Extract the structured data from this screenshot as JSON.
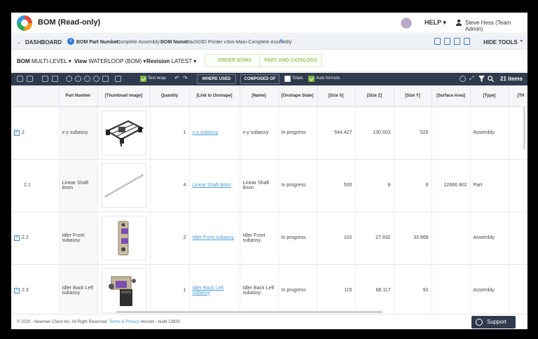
{
  "app": {
    "title": "BOM (Read-only)"
  },
  "header": {
    "help_label": "HELP ▾",
    "user_name": "Steve Hess (Team Admin)"
  },
  "dashbar": {
    "back_label": "DASHBOARD",
    "part_number_key": "BOM Part Number:",
    "part_number_value": "Complete Assembly",
    "bom_name_key": "BOM Name:",
    "bom_name_value": "Mach03D Printer v3on-Main-Complete Assembly",
    "hide_tools_label": "HIDE TOOLS ⌃"
  },
  "controls": {
    "bom_key": "BOM",
    "bom_value": "MULTI-LEVEL ▾",
    "view_key": "View",
    "view_value": "WATERLOOP (BOM) ▾",
    "revision_key": "Revision",
    "revision_value": "LATEST ▾",
    "order_boms": "ORDER BOMS",
    "part_catalog": "PART AND CATALOGS"
  },
  "toolbar": {
    "text_wrap": "Text wrap",
    "where_used": "WHERE USED",
    "composed_of": "COMPOSED OF",
    "totals": "Totals",
    "auto_formula": "Auto formula",
    "item_count": "21 items"
  },
  "table": {
    "columns": [
      "",
      "Part Number",
      "[Thumbnail image]",
      "Quantity",
      "[Link to Onshape]",
      "[Name]",
      "[Onshape State]",
      "[Size X]",
      "[Size Z]",
      "[Size Y]",
      "[Surface Area]",
      "[Type]",
      "[TH"
    ],
    "rows": [
      {
        "id": "2",
        "expandable": true,
        "part_number": "x-y subassy",
        "thumb": "xy",
        "quantity": "1",
        "link": "x-y subassy",
        "name": "x-y subassy",
        "state": "In progress",
        "size_x": "544.427",
        "size_z": "130.503",
        "size_y": "525",
        "surface_area": "",
        "type": "Assembly"
      },
      {
        "id": "2.1",
        "expandable": false,
        "part_number": "Linear Shaft 8mm",
        "thumb": "shaft",
        "quantity": "4",
        "link": "Linear Shaft 8mm",
        "name": "Linear Shaft 8mm",
        "state": "In progress",
        "size_x": "500",
        "size_z": "8",
        "size_y": "8",
        "surface_area": "12666.902",
        "type": "Part"
      },
      {
        "id": "2.2",
        "expandable": true,
        "part_number": "Idler Front subassy",
        "thumb": "idler-front",
        "quantity": "2",
        "link": "Idler Front subassy",
        "name": "Idler Front subassy",
        "state": "In progress",
        "size_x": "102",
        "size_z": "27.932",
        "size_y": "33.966",
        "surface_area": "",
        "type": "Assembly"
      },
      {
        "id": "2.3",
        "expandable": true,
        "part_number": "Idler Back Left subassy",
        "thumb": "idler-back",
        "quantity": "1",
        "link": "Idler Back Left subassy",
        "name": "Idler Back Left subassy",
        "state": "In progress",
        "size_x": "115",
        "size_z": "68.117",
        "size_y": "92",
        "surface_area": "",
        "type": "Assembly"
      }
    ]
  },
  "footer": {
    "copyright": "© 2020 - Newman Cloud Inc. All Right Reserved.",
    "terms": "Terms",
    "amp": "&",
    "privacy": "Privacy",
    "version": "Version - build 13839",
    "support": "Support"
  },
  "colors": {
    "toolbar": "#2f3a4d",
    "accent": "#2d7dd2",
    "green": "#7fb342",
    "link": "#4a9bd8"
  }
}
